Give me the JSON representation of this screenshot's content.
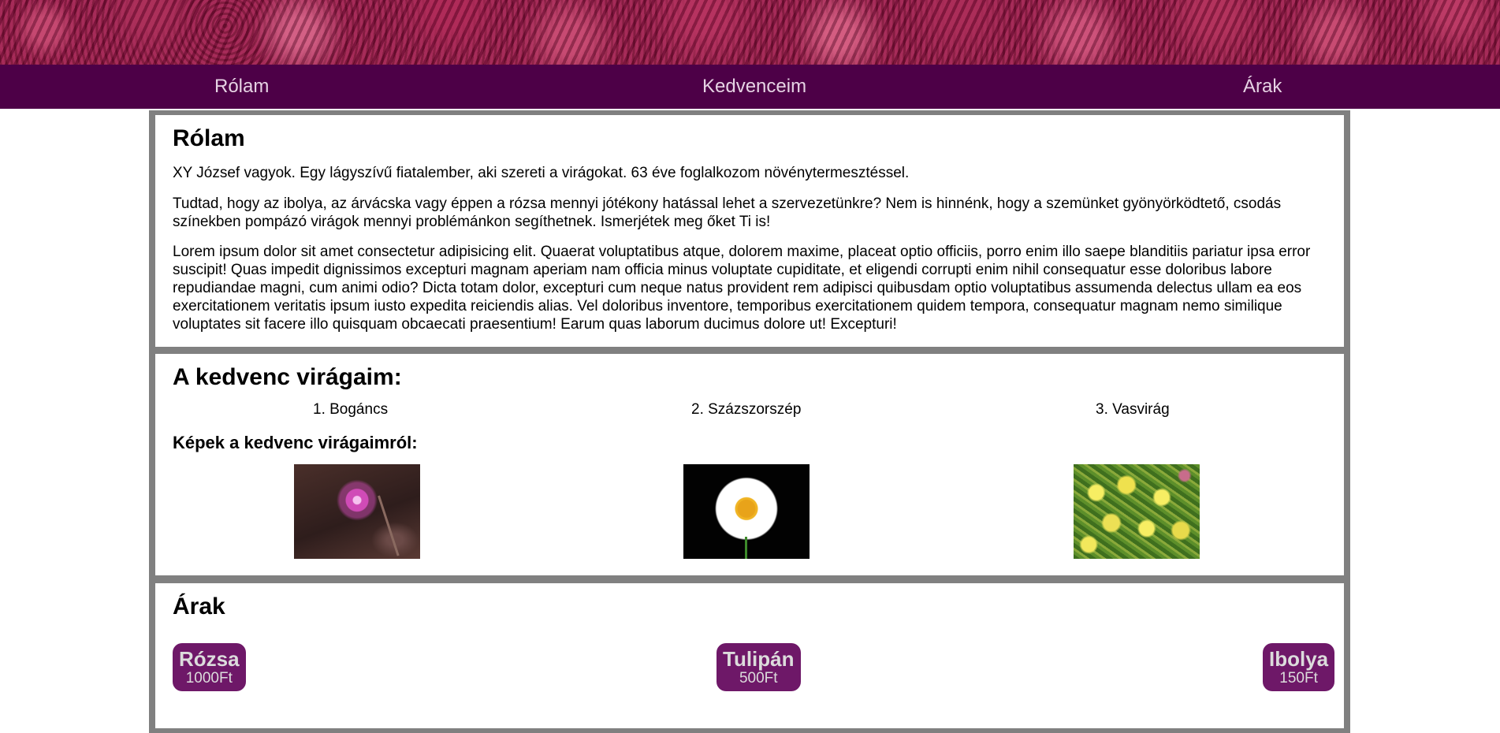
{
  "nav": {
    "items": [
      {
        "label": "Rólam"
      },
      {
        "label": "Kedvenceim"
      },
      {
        "label": "Árak"
      }
    ]
  },
  "about": {
    "title": "Rólam",
    "paragraphs": [
      "XY József vagyok. Egy lágyszívű fiatalember, aki szereti a virágokat. 63 éve foglalkozom növénytermesztéssel.",
      "Tudtad, hogy az ibolya, az árvácska vagy éppen a rózsa mennyi jótékony hatással lehet a szervezetünkre? Nem is hinnénk, hogy a szemünket gyönyörködtető, csodás színekben pompázó virágok mennyi problémánkon segíthetnek. Ismerjétek meg őket Ti is!",
      "Lorem ipsum dolor sit amet consectetur adipisicing elit. Quaerat voluptatibus atque, dolorem maxime, placeat optio officiis, porro enim illo saepe blanditiis pariatur ipsa error suscipit! Quas impedit dignissimos excepturi magnam aperiam nam officia minus voluptate cupiditate, et eligendi corrupti enim nihil consequatur esse doloribus labore repudiandae magni, cum animi odio? Dicta totam dolor, excepturi cum neque natus provident rem adipisci quibusdam optio voluptatibus assumenda delectus ullam ea eos exercitationem veritatis ipsum iusto expedita reiciendis alias. Vel doloribus inventore, temporibus exercitationem quidem tempora, consequatur magnam nemo similique voluptates sit facere illo quisquam obcaecati praesentium! Earum quas laborum ducimus dolore ut! Excepturi!"
    ]
  },
  "favorites": {
    "title": "A kedvenc virágaim:",
    "items": [
      "1. Bogáncs",
      "2. Százszorszép",
      "3. Vasvirág"
    ],
    "pictures_title": "Képek a kedvenc virágaimról:"
  },
  "prices": {
    "title": "Árak",
    "items": [
      {
        "name": "Rózsa",
        "price": "1000Ft"
      },
      {
        "name": "Tulipán",
        "price": "500Ft"
      },
      {
        "name": "Ibolya",
        "price": "150Ft"
      }
    ]
  },
  "colors": {
    "nav_background": "#4d0047",
    "nav_text": "#e6d3e4",
    "container_border": "#808080",
    "price_badge": "#6e1868"
  }
}
